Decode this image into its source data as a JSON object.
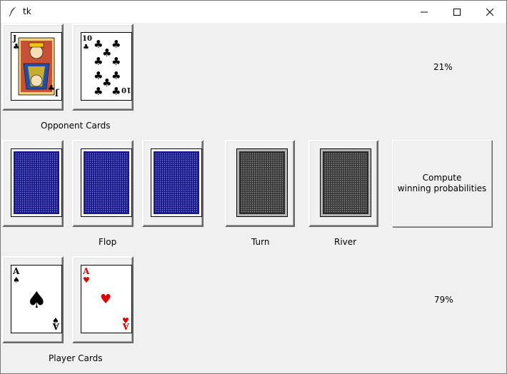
{
  "window": {
    "title": "tk",
    "app_icon": "feather-icon"
  },
  "window_controls": {
    "minimize": "minimize-icon",
    "maximize": "maximize-icon",
    "close": "close-icon"
  },
  "opponent": {
    "label": "Opponent Cards",
    "win_probability": "21%",
    "cards": [
      {
        "rank": "J",
        "suit": "clubs",
        "suit_symbol": "♣",
        "color": "#000000"
      },
      {
        "rank": "10",
        "suit": "clubs",
        "suit_symbol": "♣",
        "color": "#000000"
      }
    ]
  },
  "board": {
    "flop_label": "Flop",
    "turn_label": "Turn",
    "river_label": "River",
    "flop_back_color": "#1a1a8c",
    "turn_river_back_color": "#555555"
  },
  "compute_button": {
    "line1": "Compute",
    "line2": "winning probabilities"
  },
  "player": {
    "label": "Player Cards",
    "win_probability": "79%",
    "cards": [
      {
        "rank": "A",
        "suit": "spades",
        "suit_symbol": "♠",
        "color": "#000000"
      },
      {
        "rank": "A",
        "suit": "hearts",
        "suit_symbol": "♥",
        "color": "#e00000"
      }
    ]
  }
}
